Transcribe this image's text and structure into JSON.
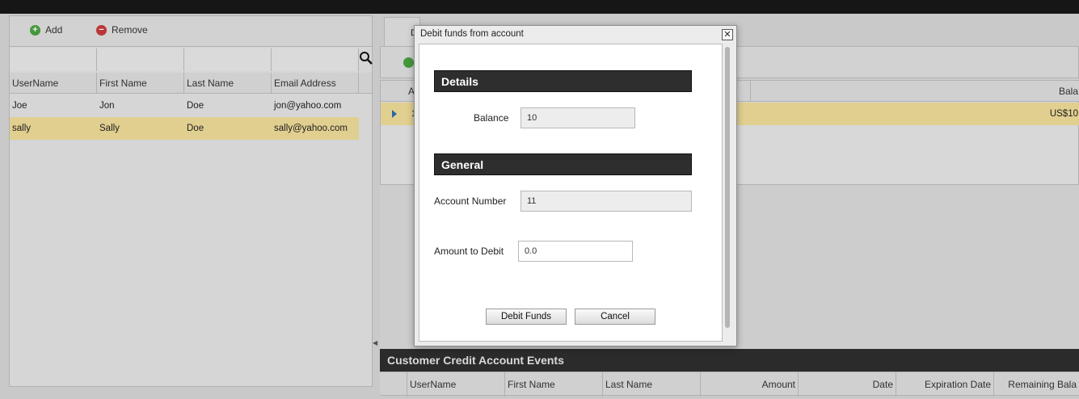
{
  "left_panel": {
    "add_label": "Add",
    "remove_label": "Remove",
    "columns": [
      "UserName",
      "First Name",
      "Last Name",
      "Email Address"
    ],
    "rows": [
      {
        "username": "Joe",
        "first": "Jon",
        "last": "Doe",
        "email": "jon@yahoo.com"
      },
      {
        "username": "sally",
        "first": "Sally",
        "last": "Doe",
        "email": "sally@yahoo.com"
      }
    ],
    "selected_row": 1
  },
  "right_panel": {
    "tab_label": "D",
    "grid_col_first": "A",
    "grid_col_balance": "Bala",
    "row_first": "1",
    "row_amount": "US$10",
    "events_title": "Customer Credit Account Events",
    "events_columns": [
      "UserName",
      "First Name",
      "Last Name",
      "Amount",
      "Date",
      "Expiration Date",
      "Remaining Bala"
    ]
  },
  "dialog": {
    "title": "Debit funds from account",
    "details_header": "Details",
    "balance_label": "Balance",
    "balance_value": "10",
    "general_header": "General",
    "account_number_label": "Account Number",
    "account_number_value": "11",
    "amount_label": "Amount to Debit",
    "amount_value": "0.0",
    "debit_button": "Debit Funds",
    "cancel_button": "Cancel"
  }
}
